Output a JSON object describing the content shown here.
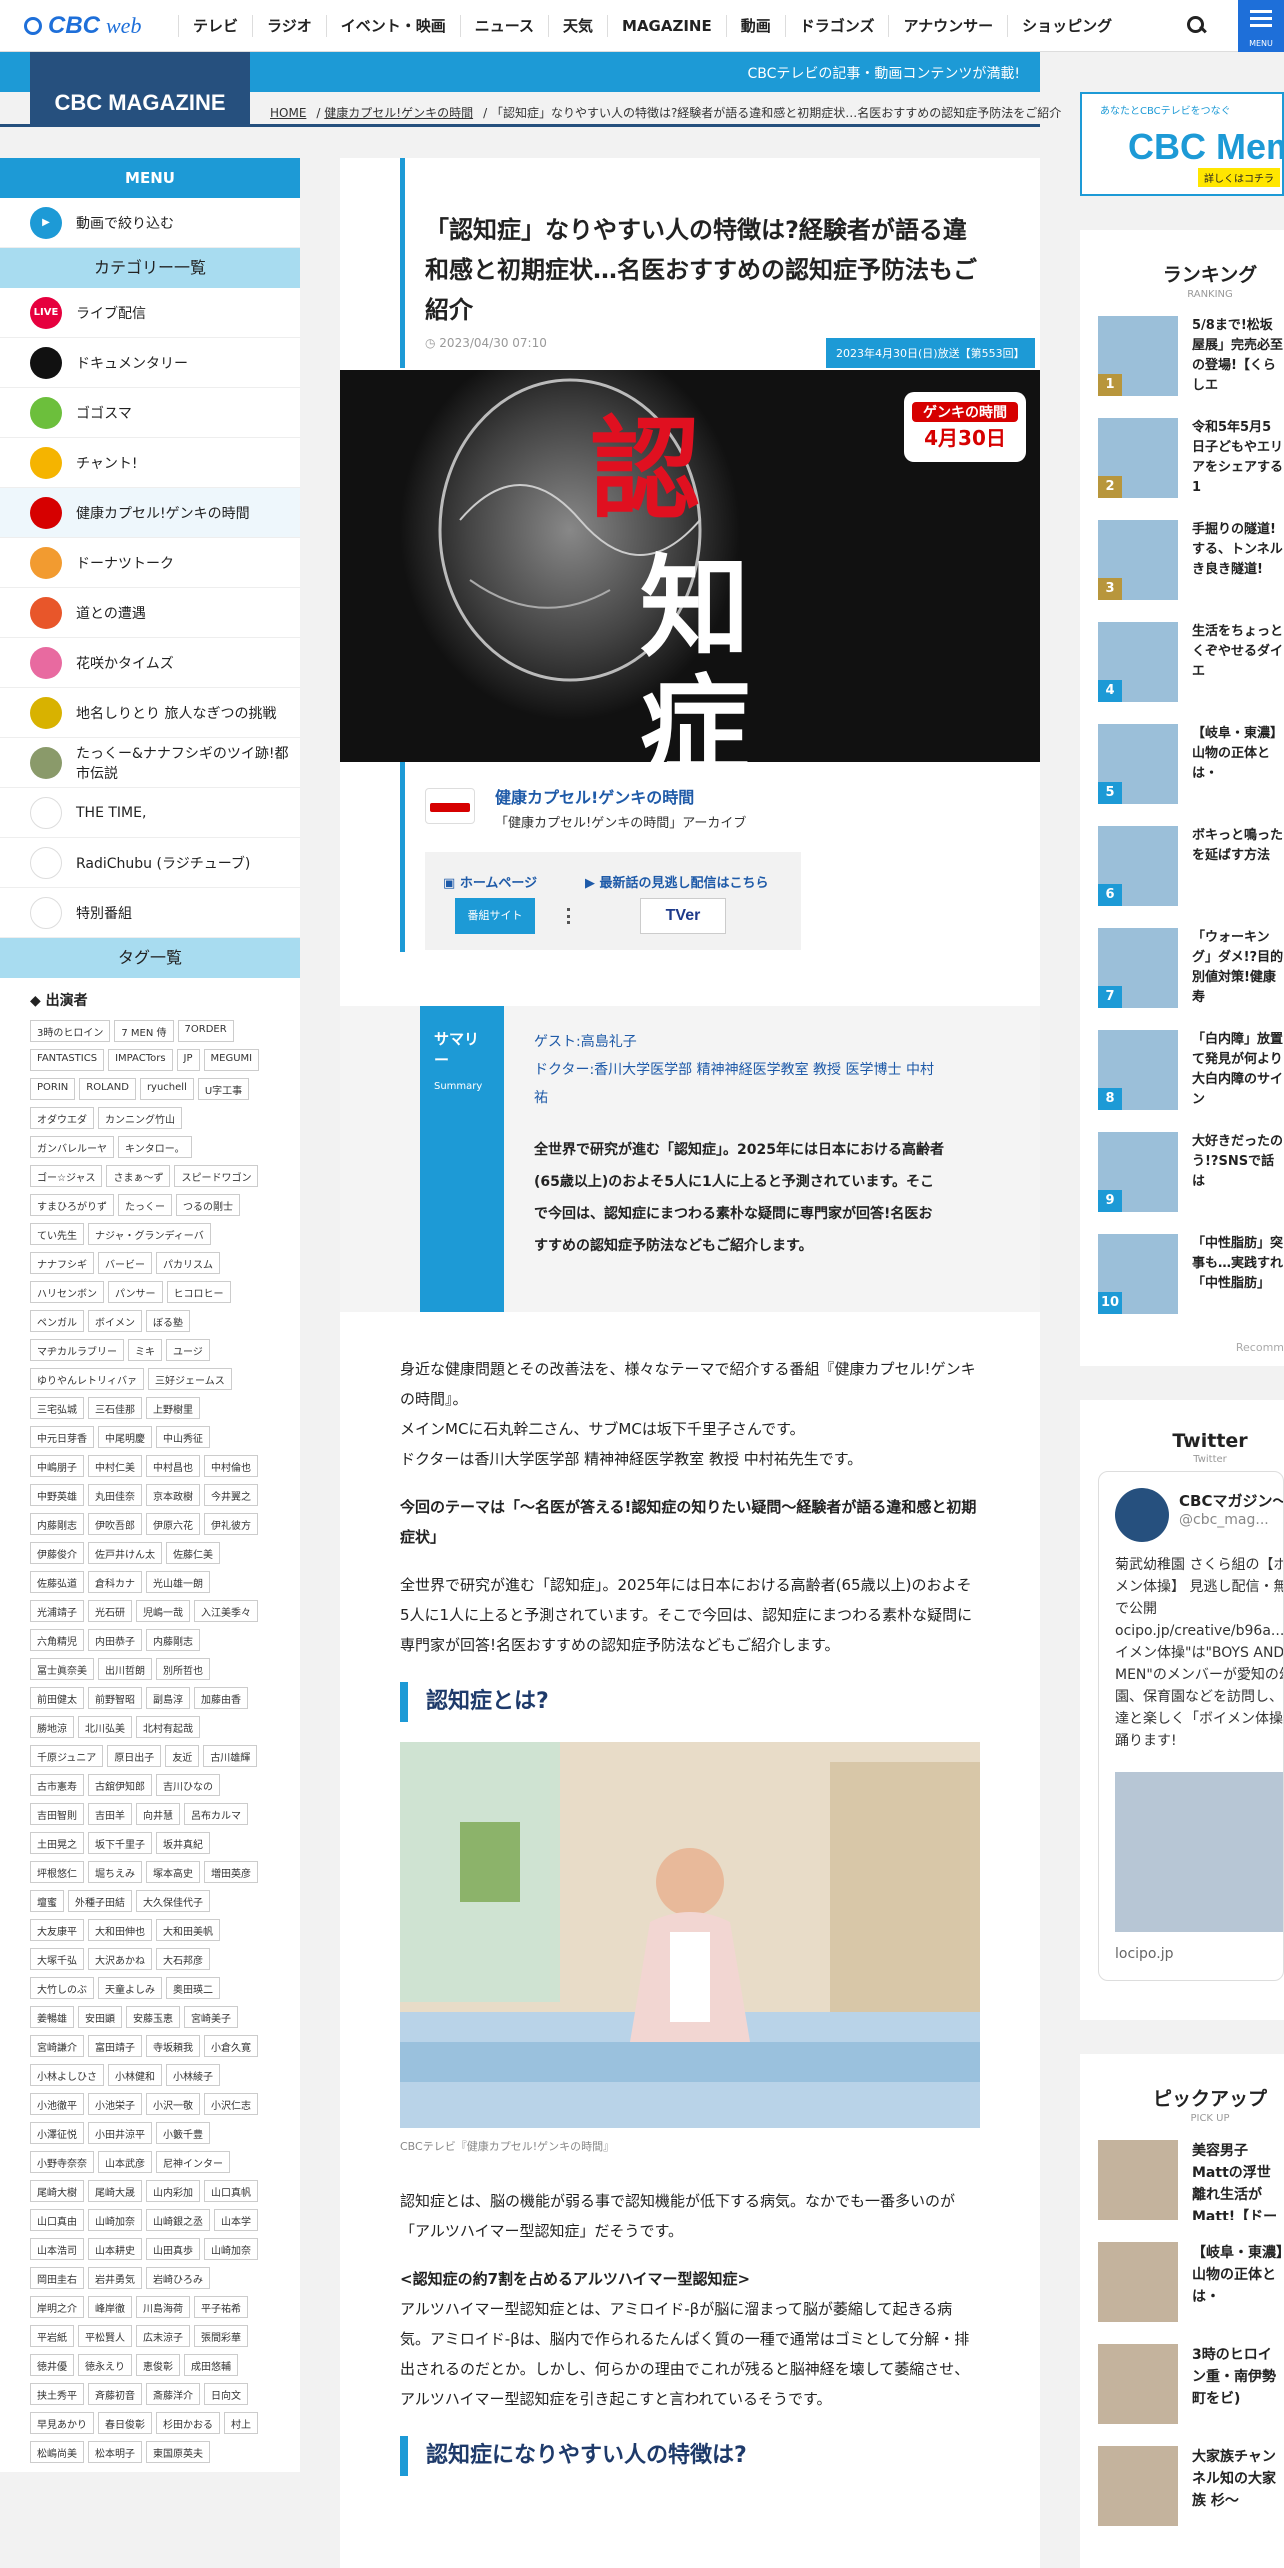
{
  "nav": {
    "logo_cbc": "CBC",
    "logo_web": "web",
    "items": [
      "テレビ",
      "ラジオ",
      "イベント・映画",
      "ニュース",
      "天気",
      "MAGAZINE",
      "動画",
      "ドラゴンズ",
      "アナウンサー",
      "ショッピング"
    ],
    "menu_label": "MENU"
  },
  "banner": {
    "text": "CBCテレビの記事・動画コンテンツが満載!",
    "mag": "CBC MAGAZINE"
  },
  "breadcrumb": [
    "HOME",
    "健康カプセル!ゲンキの時間",
    "「認知症」なりやすい人の特徴は?経験者が語る違和感と初期症状…名医おすすめの認知症予防法をご紹介"
  ],
  "sidebar": {
    "menu_head": "MENU",
    "video": "動画で絞り込む",
    "cat_head": "カテゴリー一覧",
    "categories": [
      {
        "label": "ライブ配信",
        "color": "#e6003e",
        "icon": "LIVE"
      },
      {
        "label": "ドキュメンタリー",
        "color": "#111111",
        "icon": ""
      },
      {
        "label": "ゴゴスマ",
        "color": "#6cbf3c",
        "icon": ""
      },
      {
        "label": "チャント!",
        "color": "#f5b400",
        "icon": ""
      },
      {
        "label": "健康カプセル!ゲンキの時間",
        "color": "#d60000",
        "icon": ""
      },
      {
        "label": "ドーナツトーク",
        "color": "#f29b30",
        "icon": ""
      },
      {
        "label": "道との遭遇",
        "color": "#e8562a",
        "icon": ""
      },
      {
        "label": "花咲かタイムズ",
        "color": "#e86aa0",
        "icon": ""
      },
      {
        "label": "地名しりとり 旅人なぎつの挑戦",
        "color": "#d8b200",
        "icon": ""
      },
      {
        "label": "たっくー&ナナフシギのツイ跡!都市伝説",
        "color": "#8a9a6a",
        "icon": ""
      },
      {
        "label": "THE TIME,",
        "color": "#ffffff",
        "icon": ""
      },
      {
        "label": "RadiChubu (ラジチューブ)",
        "color": "#ffffff",
        "icon": ""
      },
      {
        "label": "特別番組",
        "color": "#ffffff",
        "icon": ""
      }
    ],
    "active_index": 4,
    "tag_head": "タグ一覧",
    "tag_sub": "出演者",
    "tags": [
      "3時のヒロイン",
      "7 MEN 侍",
      "7ORDER",
      "FANTASTICS",
      "IMPACTors",
      "JP",
      "MEGUMI",
      "PORIN",
      "ROLAND",
      "ryuchell",
      "U字工事",
      "オダウエダ",
      "カンニング竹山",
      "ガンバレルーヤ",
      "キンタロー。",
      "ゴー☆ジャス",
      "さまぁ〜ず",
      "スピードワゴン",
      "すまひろがりず",
      "たっくー",
      "つるの剛士",
      "てい先生",
      "ナジャ・グランディーバ",
      "ナナフシギ",
      "バービー",
      "パカリスム",
      "ハリセンボン",
      "パンサー",
      "ヒコロヒー",
      "ペンガル",
      "ボイメン",
      "ぼる塾",
      "マヂカルラブリー",
      "ミキ",
      "ユージ",
      "ゆりやんレトリィバァ",
      "三好ジェームス",
      "三宅弘城",
      "三石佳那",
      "上野樹里",
      "中元日芽香",
      "中尾明慶",
      "中山秀征",
      "中嶋朋子",
      "中村仁美",
      "中村昌也",
      "中村倫也",
      "中野英雄",
      "丸田佳奈",
      "京本政樹",
      "今井翼之",
      "内藤剛志",
      "伊吹吾郎",
      "伊原六花",
      "伊礼彼方",
      "伊藤俊介",
      "佐戸井けん太",
      "佐藤仁美",
      "佐藤弘道",
      "倉科カナ",
      "光山雄一朗",
      "光浦靖子",
      "光石研",
      "児嶋一哉",
      "入江美季々",
      "六角精児",
      "内田恭子",
      "内藤剛志",
      "冨士眞奈美",
      "出川哲朗",
      "別所哲也",
      "前田健太",
      "前野智昭",
      "副島淳",
      "加藤由香",
      "勝地涼",
      "北川弘美",
      "北村有起哉",
      "千原ジュニア",
      "原日出子",
      "友近",
      "古川雄輝",
      "古市憲寿",
      "古舘伊知郎",
      "吉川ひなの",
      "吉田智則",
      "吉田羊",
      "向井慧",
      "呂布カルマ",
      "土田晃之",
      "坂下千里子",
      "坂井真紀",
      "坪根悠仁",
      "堀ちえみ",
      "塚本高史",
      "増田英彦",
      "壇蜜",
      "外種子田結",
      "大久保佳代子",
      "大友康平",
      "大和田伸也",
      "大和田美帆",
      "大塚千弘",
      "大沢あかね",
      "大石邦彦",
      "大竹しのぶ",
      "天童よしみ",
      "奥田瑛二",
      "姜暢雄",
      "安田顕",
      "安藤玉恵",
      "宮崎美子",
      "宮崎謙介",
      "富田靖子",
      "寺坂頼我",
      "小倉久寛",
      "小林よしひさ",
      "小林健和",
      "小林綾子",
      "小池徹平",
      "小池栄子",
      "小沢一敬",
      "小沢仁志",
      "小澤征悦",
      "小田井涼平",
      "小籔千豊",
      "小野寺奈奈",
      "山本武彦",
      "尼神インター",
      "尾崎大樹",
      "尾崎大晟",
      "山内彩加",
      "山口真帆",
      "山口真由",
      "山崎加奈",
      "山崎銀之丞",
      "山本学",
      "山本浩司",
      "山本耕史",
      "山田真歩",
      "山崎加奈",
      "岡田圭右",
      "岩井勇気",
      "岩崎ひろみ",
      "岸明之介",
      "峰岸徹",
      "川島海荷",
      "平子祐希",
      "平岩紙",
      "平松賢人",
      "広末涼子",
      "張間彩華",
      "徳井優",
      "徳永えり",
      "恵俊彰",
      "成田悠輔",
      "挟土秀平",
      "斉藤初音",
      "斎藤洋介",
      "日向文",
      "早見あかり",
      "春日俊彰",
      "杉田かおる",
      "村上",
      "松嶋尚美",
      "松本明子",
      "東国原英夫"
    ]
  },
  "article": {
    "title": "「認知症」なりやすい人の特徴は?経験者が語る違和感と初期症状…名医おすすめの認知症予防法もご紹介",
    "date": "2023/04/30 07:10",
    "episode": "2023年4月30日(日)放送【第553回】",
    "hero_chars": [
      "認",
      "知",
      "症"
    ],
    "hero_badge_title": "ゲンキの時間",
    "hero_badge_date": "4月30日",
    "program_name": "健康カプセル!ゲンキの時間",
    "program_archive": "「健康カプセル!ゲンキの時間」アーカイブ",
    "link_home": "ホームページ",
    "link_latest": "最新話の見逃し配信はこちら",
    "btn_site": "番組サイト",
    "tver": "TVer",
    "summary_label": "サマリー",
    "summary_sub": "Summary",
    "guest": "ゲスト:高島礼子",
    "doctor": "ドクター:香川大学医学部 精神神経医学教室 教授 医学博士 中村祐",
    "summary": "全世界で研究が進む「認知症」。2025年には日本における高齢者(65歳以上)のおよそ5人に1人に上ると予測されています。そこで今回は、認知症にまつわる素朴な疑問に専門家が回答!名医おすすめの認知症予防法などもご紹介します。",
    "p1": "身近な健康問題とその改善法を、様々なテーマで紹介する番組『健康カプセル!ゲンキの時間』。",
    "p1b": "メインMCに石丸幹二さん、サブMCは坂下千里子さんです。",
    "p1c": "ドクターは香川大学医学部 精神神経医学教室 教授 中村祐先生です。",
    "p2": "今回のテーマは「〜名医が答える!認知症の知りたい疑問〜経験者が語る違和感と初期症状」",
    "p3": "全世界で研究が進む「認知症」。2025年には日本における高齢者(65歳以上)のおよそ5人に1人に上ると予測されています。そこで今回は、認知症にまつわる素朴な疑問に専門家が回答!名医おすすめの認知症予防法などもご紹介します。",
    "h2a": "認知症とは?",
    "caption": "CBCテレビ『健康カプセル!ゲンキの時間』",
    "p4": "認知症とは、脳の機能が弱る事で認知機能が低下する病気。なかでも一番多いのが「アルツハイマー型認知症」だそうです。",
    "sub1": "<認知症の約7割を占めるアルツハイマー型認知症>",
    "p5": "アルツハイマー型認知症とは、アミロイド-βが脳に溜まって脳が萎縮して起きる病気。アミロイド-βは、脳内で作られるたんぱく質の一種で通常はゴミとして分解・排出されるのだとか。しかし、何らかの理由でこれが残ると脳神経を壊して萎縮させ、アルツハイマー型認知症を引き起こすと言われているそうです。",
    "h2b": "認知症になりやすい人の特徴は?"
  },
  "right": {
    "ad_top": "あなたとCBCテレビをつなぐ",
    "ad_main": "CBC Mem",
    "ad_link": "詳しくはコチラ",
    "ranking_head": "ランキング",
    "ranking_sub": "RANKING",
    "ranking": [
      {
        "n": "1",
        "t": "5/8まで!松坂屋展」完売必至の登場!【くらしエ",
        "c": "#b8963c"
      },
      {
        "n": "2",
        "t": "令和5年5月5日子どもやエリアをシェアする1",
        "c": "#b8963c"
      },
      {
        "n": "3",
        "t": "手掘りの隧道!する、トンネルき良き隧道!",
        "c": "#b8963c"
      },
      {
        "n": "4",
        "t": "生活をちょっとくぞやせるダイエ",
        "c": "#1d9ad6"
      },
      {
        "n": "5",
        "t": "【岐阜・東濃】山物の正体とは・",
        "c": "#1d9ad6"
      },
      {
        "n": "6",
        "t": "ボキっと鳴ったを延ばす方法",
        "c": "#1d9ad6"
      },
      {
        "n": "7",
        "t": "「ウォーキング」ダメ!?目的別値対策!健康寿",
        "c": "#1d9ad6"
      },
      {
        "n": "8",
        "t": "「白内障」放置て発見が何より大白内障のサイン",
        "c": "#1d9ad6"
      },
      {
        "n": "9",
        "t": "大好きだったのう!?SNSで話は",
        "c": "#1d9ad6"
      },
      {
        "n": "10",
        "t": "「中性脂肪」突事も…実践すれ「中性脂肪」",
        "c": "#1d9ad6"
      }
    ],
    "ranking_more": "Recomm",
    "twitter_head": "Twitter",
    "twitter_sub": "Twitter",
    "tw_name": "CBCマガジン〜",
    "tw_handle": "@cbc_mag...",
    "tw_text": "菊武幼稚園 さくら組の【ボイメン体操】 見逃し配信・無料で公開 ocipo.jp/creative/b96a... \"ボイメン体操\"は\"BOYS AND MEN\"のメンバーが愛知の幼稚園、保育園などを訪問し、子供達と楽しく「ボイメン体操」を踊ります!",
    "tw_domain": "locipo.jp",
    "pick_head": "ピックアップ",
    "pick_sub": "PICK UP",
    "picks": [
      "美容男子Mattの浮世離れ生活がMatt!【ドーナ",
      "【岐阜・東濃】山物の正体とは・",
      "3時のヒロイン重・南伊勢町をビ)",
      "大家族チャンネル知の大家族 杉〜"
    ]
  }
}
